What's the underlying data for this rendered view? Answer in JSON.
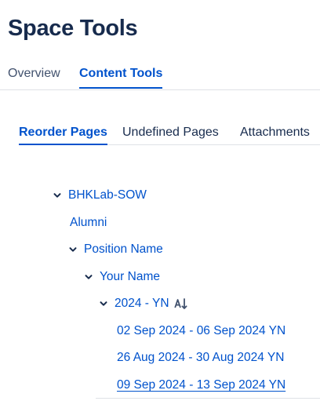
{
  "header": {
    "title": "Space Tools"
  },
  "main_tabs": [
    {
      "label": "Overview",
      "active": false
    },
    {
      "label": "Content Tools",
      "active": true
    }
  ],
  "sub_tabs": [
    {
      "label": "Reorder Pages",
      "active": true
    },
    {
      "label": "Undefined Pages",
      "active": false
    },
    {
      "label": "Attachments",
      "active": false
    }
  ],
  "tree": {
    "root": {
      "label": "BHKLab-SOW",
      "expanded": true
    },
    "alumni": {
      "label": "Alumni"
    },
    "position": {
      "label": "Position Name",
      "expanded": true
    },
    "your_name": {
      "label": "Your Name",
      "expanded": true
    },
    "year": {
      "label": "2024 - YN",
      "expanded": true,
      "sort_icon": "sort-alpha-icon"
    },
    "weeks": [
      {
        "label": "02 Sep 2024 - 06 Sep 2024 YN"
      },
      {
        "label": "26 Aug 2024 - 30 Aug 2024 YN"
      },
      {
        "label": "09 Sep 2024 - 13 Sep 2024 YN",
        "underlined": true
      }
    ]
  },
  "colors": {
    "link": "#0052cc",
    "title": "#172b4d",
    "border": "#dfe1e6"
  }
}
